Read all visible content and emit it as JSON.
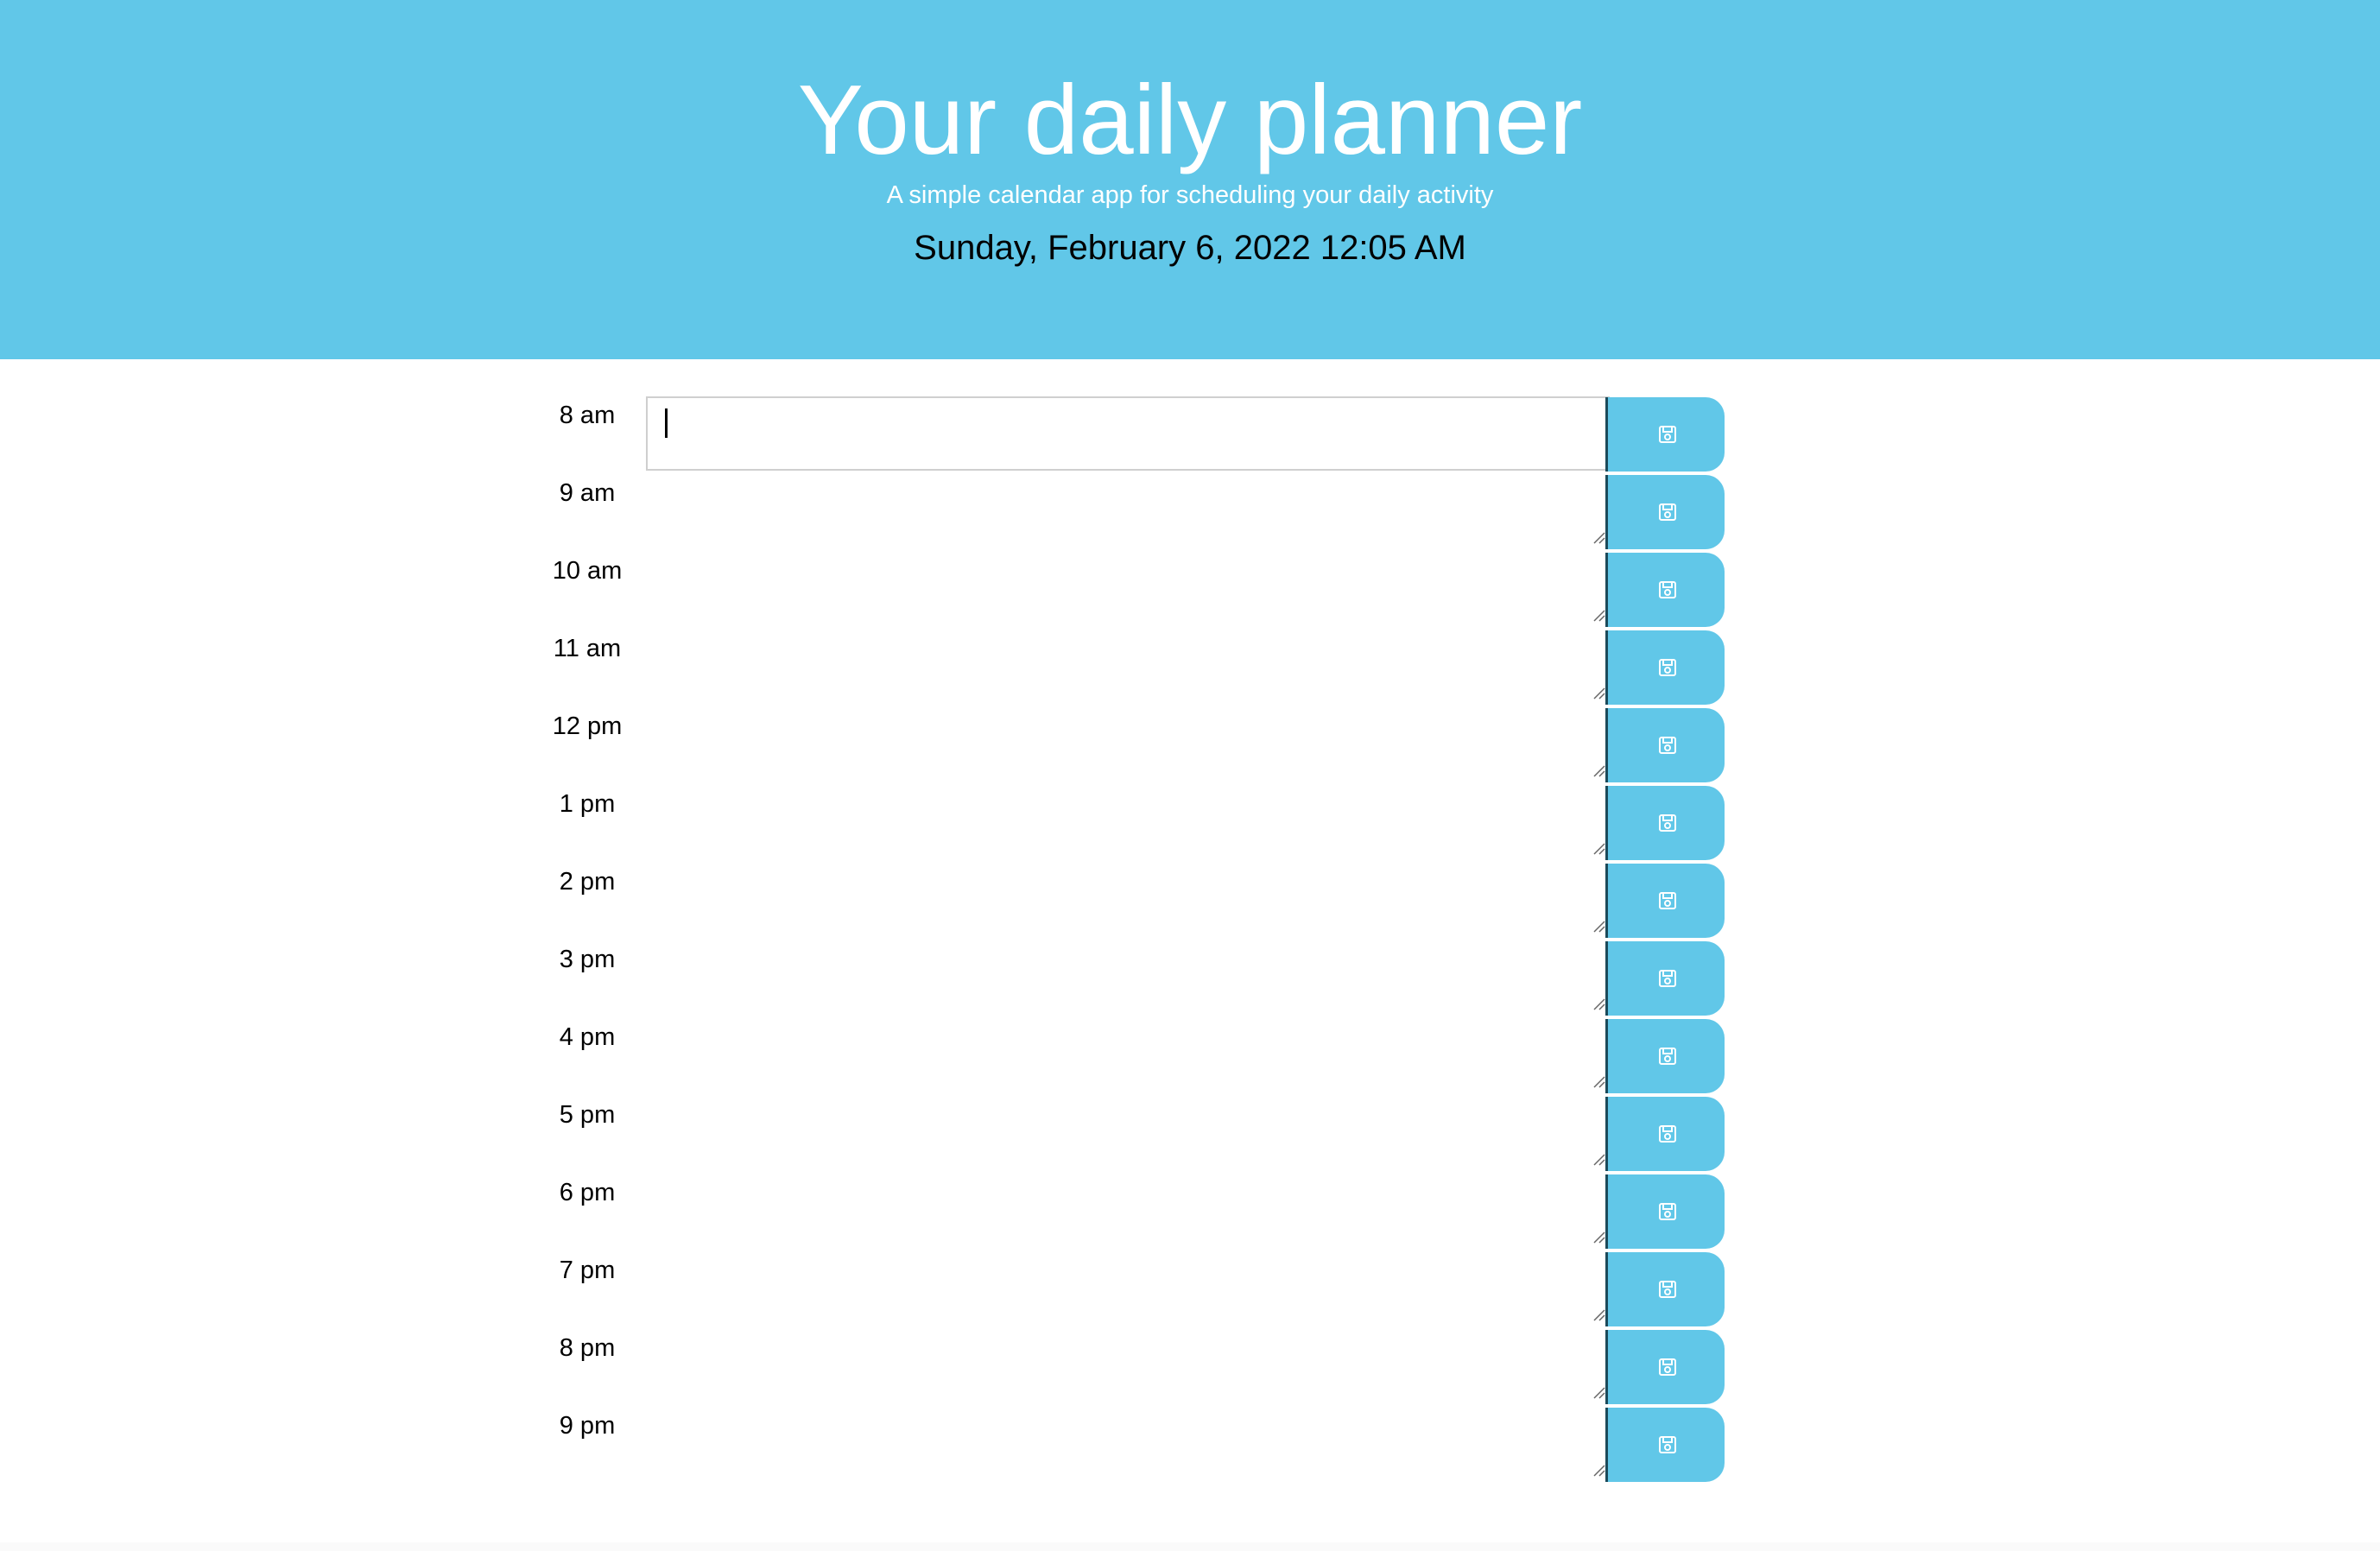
{
  "header": {
    "title": "Your daily planner",
    "subtitle": "A simple calendar app for scheduling your daily activity",
    "current_datetime": "Sunday, February 6, 2022 12:05 AM",
    "background_color": "#61c7e8"
  },
  "planner": {
    "rows": [
      {
        "hour": "8 am",
        "task": ""
      },
      {
        "hour": "9 am",
        "task": ""
      },
      {
        "hour": "10 am",
        "task": ""
      },
      {
        "hour": "11 am",
        "task": ""
      },
      {
        "hour": "12 pm",
        "task": ""
      },
      {
        "hour": "1 pm",
        "task": ""
      },
      {
        "hour": "2 pm",
        "task": ""
      },
      {
        "hour": "3 pm",
        "task": ""
      },
      {
        "hour": "4 pm",
        "task": ""
      },
      {
        "hour": "5 pm",
        "task": ""
      },
      {
        "hour": "6 pm",
        "task": ""
      },
      {
        "hour": "7 pm",
        "task": ""
      },
      {
        "hour": "8 pm",
        "task": ""
      },
      {
        "hour": "9 pm",
        "task": ""
      }
    ],
    "save_icon": "floppy-disk-icon",
    "save_button_color": "#61c7e8"
  }
}
